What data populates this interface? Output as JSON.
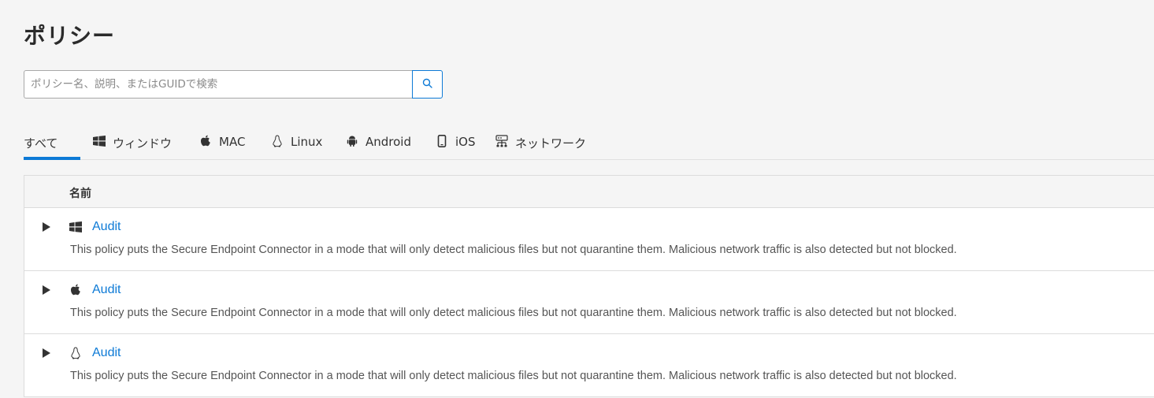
{
  "page": {
    "title": "ポリシー"
  },
  "search": {
    "placeholder": "ポリシー名、説明、またはGUIDで検索",
    "value": "",
    "button_icon": "search-icon"
  },
  "tabs": [
    {
      "label": "すべて",
      "icon": null,
      "active": true
    },
    {
      "label": "ウィンドウ",
      "icon": "windows-icon",
      "active": false
    },
    {
      "label": "MAC",
      "icon": "apple-icon",
      "active": false
    },
    {
      "label": "Linux",
      "icon": "linux-icon",
      "active": false
    },
    {
      "label": "Android",
      "icon": "android-icon",
      "active": false
    },
    {
      "label": "iOS",
      "icon": "mobile-phone-icon",
      "active": false
    },
    {
      "label": "ネットワーク",
      "icon": "network-icon",
      "active": false
    }
  ],
  "table": {
    "columns": [
      "名前"
    ],
    "rows": [
      {
        "os_icon": "windows-icon",
        "name": "Audit",
        "description": "This policy puts the Secure Endpoint Connector in a mode that will only detect malicious files but not quarantine them. Malicious network traffic is also detected but not blocked."
      },
      {
        "os_icon": "apple-icon",
        "name": "Audit",
        "description": "This policy puts the Secure Endpoint Connector in a mode that will only detect malicious files but not quarantine them. Malicious network traffic is also detected but not blocked."
      },
      {
        "os_icon": "linux-icon",
        "name": "Audit",
        "description": "This policy puts the Secure Endpoint Connector in a mode that will only detect malicious files but not quarantine them. Malicious network traffic is also detected but not blocked."
      }
    ]
  },
  "colors": {
    "accent": "#0d7ad6",
    "background": "#f5f5f5",
    "text": "#333333"
  }
}
